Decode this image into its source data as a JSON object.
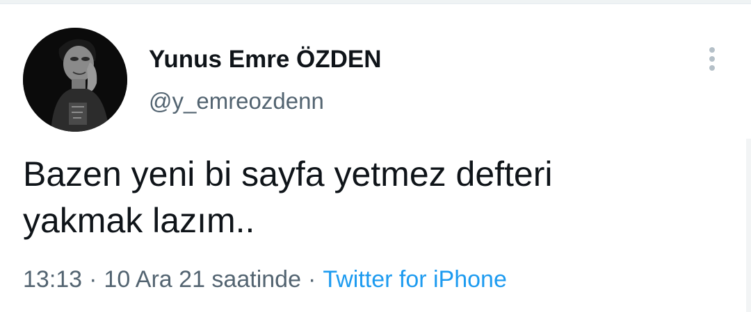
{
  "tweet": {
    "author": {
      "display_name": "Yunus Emre ÖZDEN",
      "handle": "@y_emreozdenn"
    },
    "more_menu_icon": "more-vertical-icon",
    "text_lines": [
      "Bazen yeni bi sayfa yetmez defteri",
      "yakmak lazım.."
    ],
    "time": "13:13",
    "separator": "·",
    "date": "10 Ara 21 saatinde",
    "source": "Twitter for iPhone"
  },
  "colors": {
    "text_primary": "#0f1419",
    "text_secondary": "#536471",
    "link": "#1d9bf0",
    "icon_dots": "#b5c0c8"
  }
}
